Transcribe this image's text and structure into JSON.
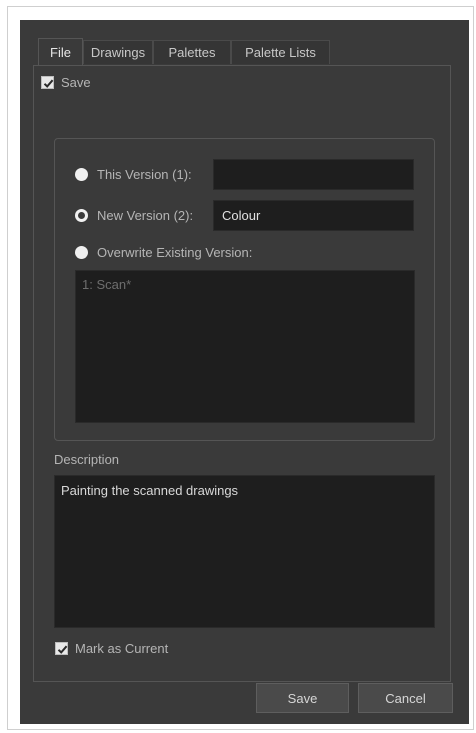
{
  "tabs": [
    {
      "label": "File",
      "active": true
    },
    {
      "label": "Drawings",
      "active": false
    },
    {
      "label": "Palettes",
      "active": false
    },
    {
      "label": "Palette Lists",
      "active": false
    }
  ],
  "save_checkbox": {
    "label": "Save",
    "checked": true
  },
  "versions": {
    "this_version": {
      "label": "This Version (1):",
      "value": "",
      "selected": false
    },
    "new_version": {
      "label": "New Version (2):",
      "value": "Colour",
      "selected": true
    },
    "overwrite": {
      "label": "Overwrite Existing Version:",
      "selected": false
    },
    "existing_list": [
      "1: Scan*"
    ]
  },
  "description": {
    "label": "Description",
    "value": "Painting the scanned drawings"
  },
  "mark_current": {
    "label": "Mark as Current",
    "checked": true
  },
  "buttons": {
    "save": "Save",
    "cancel": "Cancel"
  },
  "colors": {
    "dialog_bg": "#3a3a3a",
    "field_bg": "#1e1e1e",
    "text": "#b5b5b5"
  }
}
